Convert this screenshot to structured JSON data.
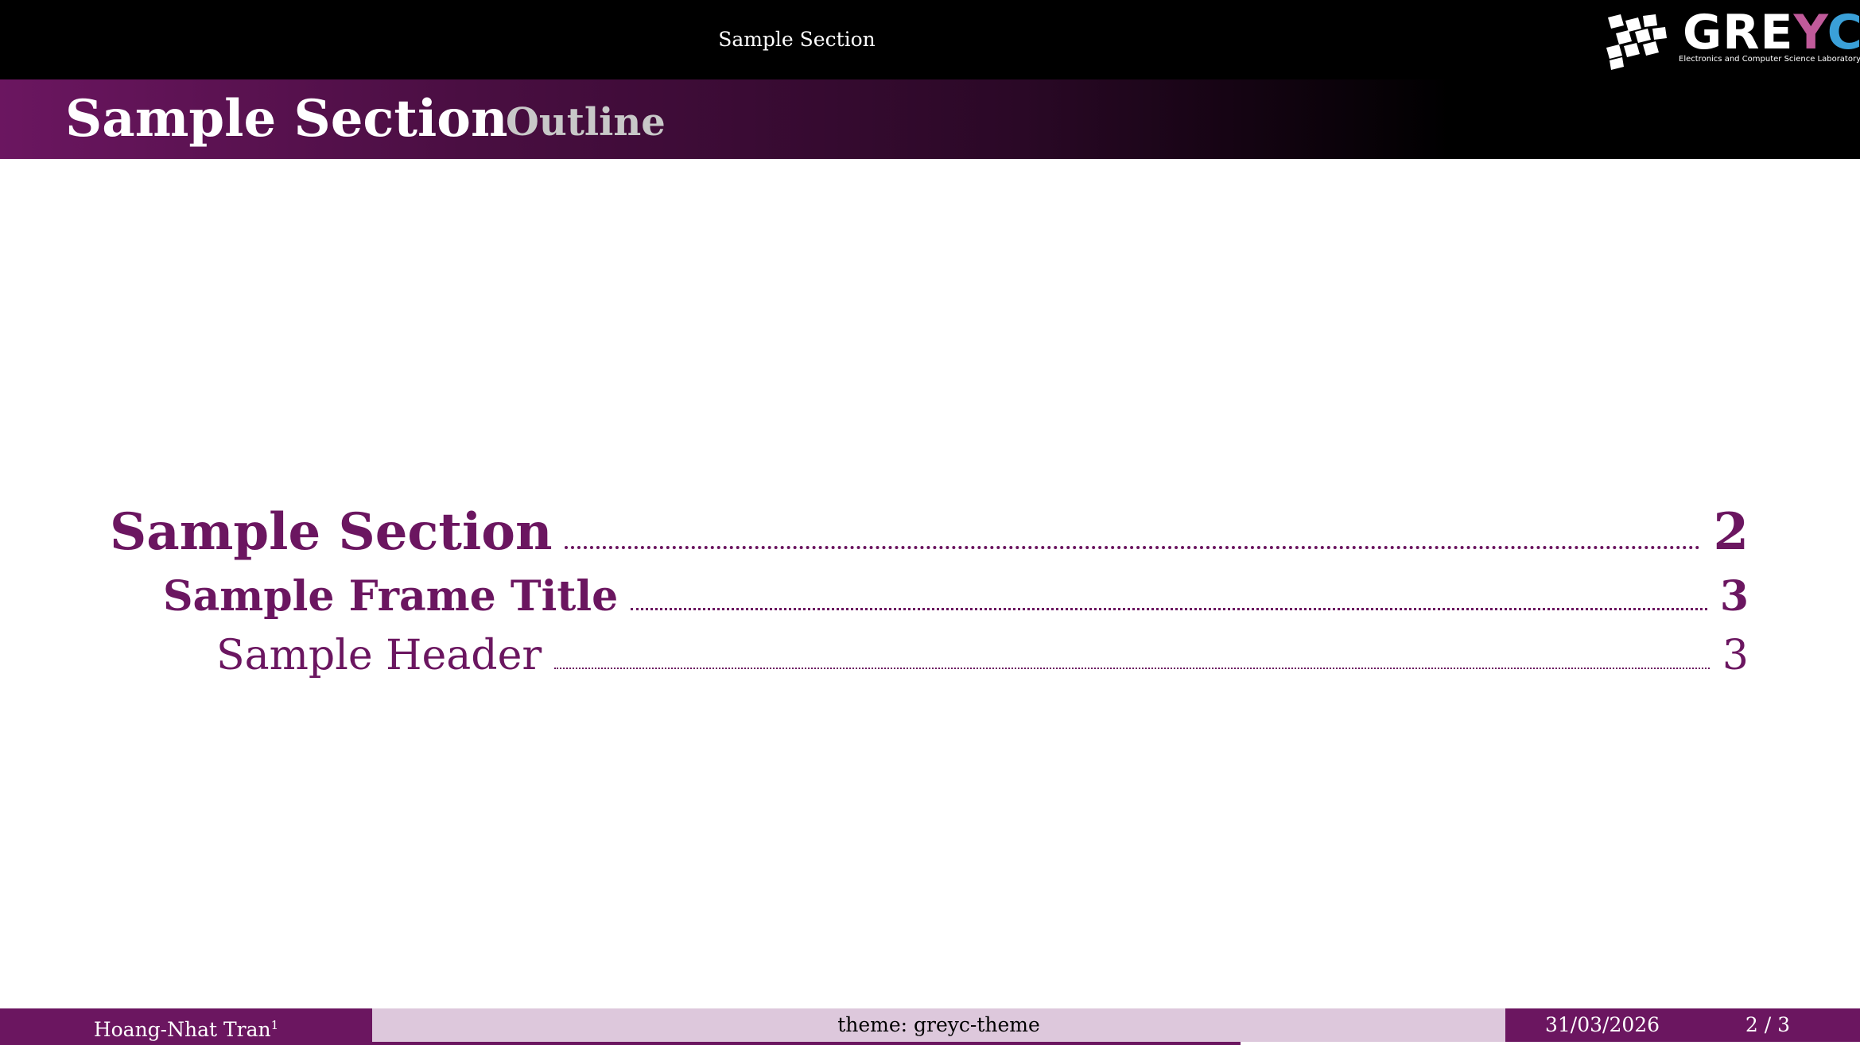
{
  "header": {
    "section_name": "Sample Section",
    "logo": {
      "word_part1": "GRE",
      "word_y": "Y",
      "word_c": "C",
      "subtitle": "Electronics and Computer Science Laboratory"
    }
  },
  "frame": {
    "title": "Sample Section",
    "subtitle": "Outline"
  },
  "toc": {
    "entries": [
      {
        "label": "Sample Section",
        "page": "2"
      },
      {
        "label": "Sample Frame Title",
        "page": "3"
      },
      {
        "label": "Sample Header",
        "page": "3"
      }
    ]
  },
  "footer": {
    "author": "Hoang-Nhat Tran",
    "author_mark": "1",
    "theme": "theme: greyc-theme",
    "date": "31/03/2026",
    "page": "2 / 3",
    "progress": 0.667
  },
  "colors": {
    "primary": "#6b1660",
    "light": "#ddc8dc",
    "header_bg": "#000000"
  }
}
